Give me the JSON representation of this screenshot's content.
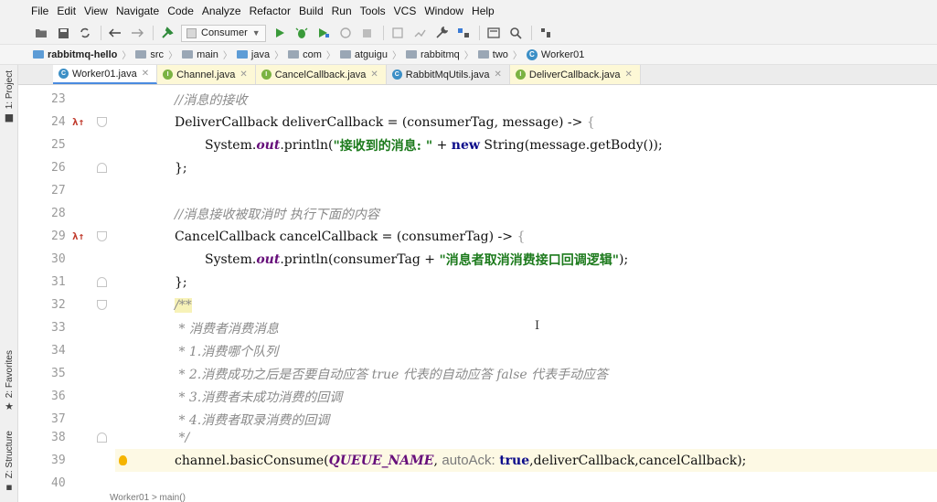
{
  "menu": [
    "File",
    "Edit",
    "View",
    "Navigate",
    "Code",
    "Analyze",
    "Refactor",
    "Build",
    "Run",
    "Tools",
    "VCS",
    "Window",
    "Help"
  ],
  "toolbar": {
    "run_config": "Consumer"
  },
  "breadcrumb": [
    "rabbitmq-hello",
    "src",
    "main",
    "java",
    "com",
    "atguigu",
    "rabbitmq",
    "two",
    "Worker01"
  ],
  "left_strip": {
    "project": "1: Project",
    "favorites": "2: Favorites",
    "structure": "Z: Structure"
  },
  "tabs": [
    {
      "label": "Worker01.java",
      "kind": "class",
      "active": true
    },
    {
      "label": "Channel.java",
      "kind": "interface",
      "active": false
    },
    {
      "label": "CancelCallback.java",
      "kind": "interface",
      "active": false
    },
    {
      "label": "RabbitMqUtils.java",
      "kind": "class",
      "active": false
    },
    {
      "label": "DeliverCallback.java",
      "kind": "interface",
      "active": false
    }
  ],
  "editor": {
    "line_numbers": [
      "23",
      "24",
      "25",
      "26",
      "27",
      "28",
      "29",
      "30",
      "31",
      "32",
      "33",
      "34",
      "35",
      "36",
      "37",
      "38",
      "39",
      "40"
    ],
    "c23": "//消息的接收",
    "c24a": "DeliverCallback deliverCallback = (consumerTag, message) -> ",
    "c24b": "{",
    "c25a": "System.",
    "c25b": "out",
    "c25c": ".println(",
    "c25d": "\"接收到的消息: \"",
    "c25e": " + ",
    "c25f": "new",
    "c25g": " String(message.getBody());",
    "c26": "};",
    "c28": "//消息接收被取消时 执行下面的内容",
    "c29a": "CancelCallback cancelCallback = (consumerTag) -> ",
    "c29b": "{",
    "c30a": "System.",
    "c30b": "out",
    "c30c": ".println(consumerTag + ",
    "c30d": "\"消息者取消消费接口回调逻辑\"",
    "c30e": ");",
    "c31": "};",
    "c32": "/**",
    "c33": " * 消费者消费消息",
    "c34": " * 1.消费哪个队列",
    "c35": " * 2.消费成功之后是否要自动应答 true 代表的自动应答 false 代表手动应答",
    "c36": " * 3.消费者未成功消费的回调",
    "c37": " * 4.消费者取录消费的回调",
    "c38": " */",
    "c39a": "channel.basicConsume(",
    "c39b": "QUEUE_NAME",
    "c39c": ", ",
    "c39d": "autoAck:",
    "c39e": " ",
    "c39f": "true",
    "c39g": ",deliverCallback,cancelCallback);",
    "lambda_marker": "λ↑"
  },
  "cursor": "I",
  "status_crumb": "Worker01 > main()"
}
